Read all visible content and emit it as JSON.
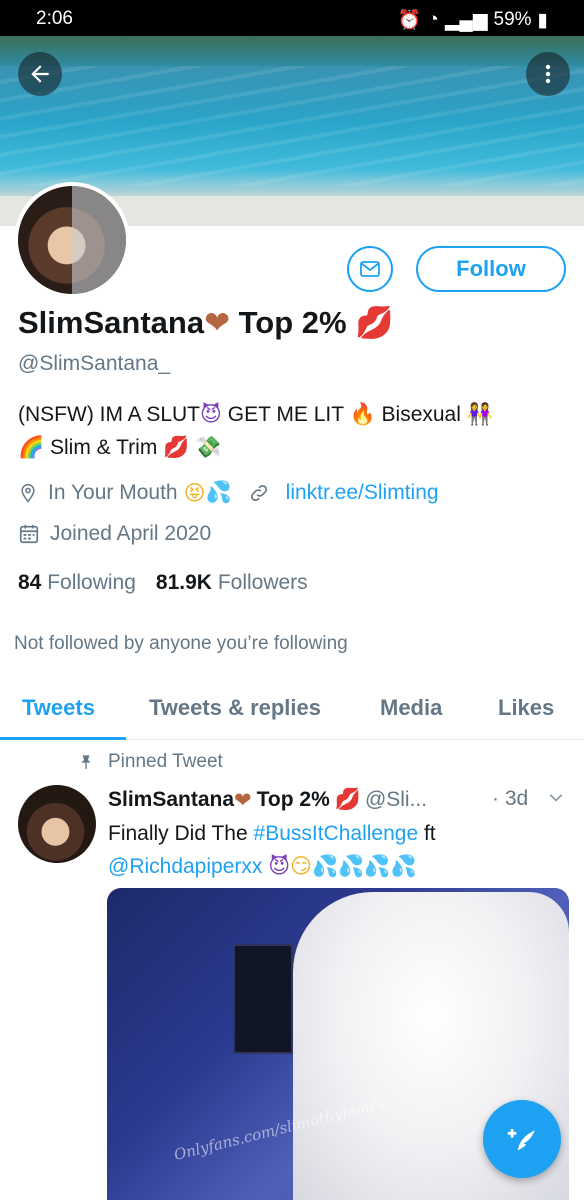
{
  "status_bar": {
    "time": "2:06",
    "battery": "59%"
  },
  "profile": {
    "display_name": "SlimSantana",
    "name_suffix": "Top 2%",
    "handle": "@SlimSantana_",
    "bio_line1": "(NSFW) IM A SLUT",
    "bio_line1b": "GET ME LIT",
    "bio_line1c": "Bisexual",
    "bio_line2": "Slim & Trim",
    "location": "In Your Mouth",
    "website": "linktr.ee/Slimting",
    "joined": "Joined April 2020",
    "following_count": "84",
    "following_label": "Following",
    "followers_count": "81.9K",
    "followers_label": "Followers",
    "not_followed": "Not followed by anyone you’re following"
  },
  "actions": {
    "follow_label": "Follow"
  },
  "tabs": [
    {
      "label": "Tweets"
    },
    {
      "label": "Tweets & replies"
    },
    {
      "label": "Media"
    },
    {
      "label": "Likes"
    }
  ],
  "pinned_tweet": {
    "pinned_label": "Pinned Tweet",
    "author_name": "SlimSantana",
    "author_suffix": "Top 2%",
    "author_handle": "@Sli...",
    "date": "· 3d",
    "text_prefix": "Finally Did The ",
    "hashtag": "#BussItChallenge",
    "text_mid": " ft",
    "mention": "@Richdapiperxx",
    "watermark": "Onlyfans.com/slimothyjames"
  },
  "colors": {
    "accent": "#1da1f2",
    "secondary_text": "#657786",
    "primary_text": "#14171a"
  },
  "icons": [
    "back-arrow-icon",
    "more-vertical-icon",
    "mail-icon",
    "location-pin-icon",
    "link-icon",
    "calendar-icon",
    "pin-icon",
    "chevron-down-icon",
    "compose-tweet-icon"
  ]
}
